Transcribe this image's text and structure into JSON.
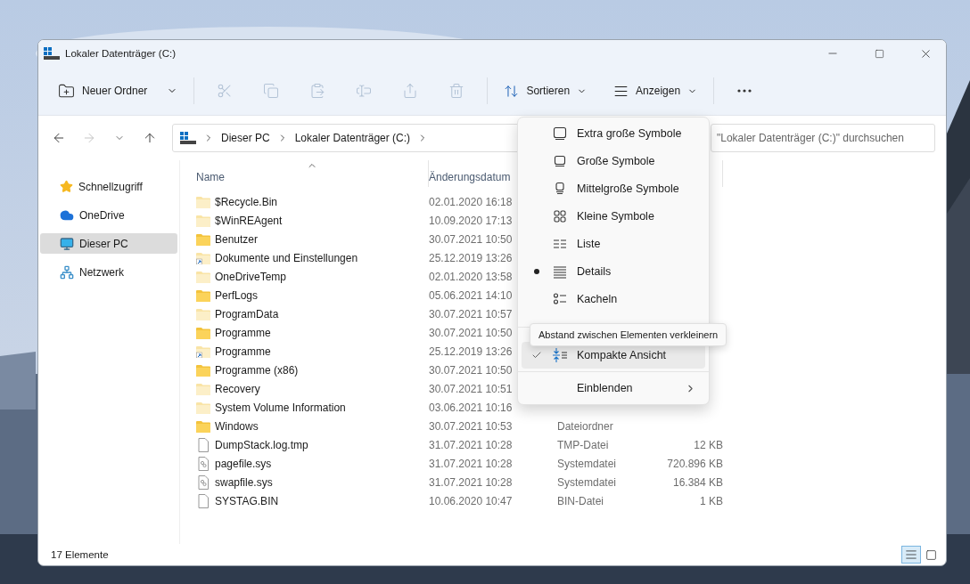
{
  "window": {
    "title": "Lokaler Datenträger (C:)"
  },
  "toolbar": {
    "new_button": {
      "label": "Neuer Ordner"
    },
    "actions": [
      {
        "kind": "cut",
        "disabled": true
      },
      {
        "kind": "copy",
        "disabled": true
      },
      {
        "kind": "paste",
        "disabled": true
      },
      {
        "kind": "rename",
        "disabled": true
      },
      {
        "kind": "share",
        "disabled": true
      },
      {
        "kind": "delete",
        "disabled": true
      }
    ],
    "sort_button": {
      "label": "Sortieren"
    },
    "view_button": {
      "label": "Anzeigen"
    }
  },
  "navigation": [
    {
      "kind": "back",
      "disabled": false
    },
    {
      "kind": "forward",
      "disabled": true
    },
    {
      "kind": "recent",
      "disabled": false
    },
    {
      "kind": "up",
      "disabled": false
    }
  ],
  "breadcrumb": [
    "Dieser PC",
    "Lokaler Datenträger (C:)"
  ],
  "search": {
    "placeholder": "\"Lokaler Datenträger (C:)\" durchsuchen"
  },
  "sidebar": {
    "items": [
      {
        "label": "Schnellzugriff",
        "kind": "star",
        "selected": false
      },
      {
        "label": "OneDrive",
        "kind": "cloud",
        "selected": false
      },
      {
        "label": "Dieser PC",
        "kind": "pc",
        "selected": true
      },
      {
        "label": "Netzwerk",
        "kind": "network",
        "selected": false
      }
    ]
  },
  "table": {
    "columns": [
      {
        "label": "Name",
        "sorted": true
      },
      {
        "label": "Änderungsdatum",
        "sorted": false
      }
    ],
    "rows": [
      {
        "name": "$Recycle.Bin",
        "date": "02.01.2020 16:18",
        "kind": "hidden-folder"
      },
      {
        "name": "$WinREAgent",
        "date": "10.09.2020 17:13",
        "kind": "hidden-folder"
      },
      {
        "name": "Benutzer",
        "date": "30.07.2021 10:50",
        "kind": "folder"
      },
      {
        "name": "Dokumente und Einstellungen",
        "date": "25.12.2019 13:26",
        "kind": "link"
      },
      {
        "name": "OneDriveTemp",
        "date": "02.01.2020 13:58",
        "kind": "hidden-folder"
      },
      {
        "name": "PerfLogs",
        "date": "05.06.2021 14:10",
        "kind": "folder"
      },
      {
        "name": "ProgramData",
        "date": "30.07.2021 10:57",
        "kind": "hidden-folder"
      },
      {
        "name": "Programme",
        "date": "30.07.2021 10:50",
        "kind": "folder"
      },
      {
        "name": "Programme",
        "date": "25.12.2019 13:26",
        "kind": "link"
      },
      {
        "name": "Programme (x86)",
        "date": "30.07.2021 10:50",
        "kind": "folder"
      },
      {
        "name": "Recovery",
        "date": "30.07.2021 10:51",
        "kind": "hidden-folder"
      },
      {
        "name": "System Volume Information",
        "date": "03.06.2021 10:16",
        "kind": "hidden-folder"
      },
      {
        "name": "Windows",
        "date": "30.07.2021 10:53",
        "type": "Dateiordner",
        "kind": "folder"
      },
      {
        "name": "DumpStack.log.tmp",
        "date": "31.07.2021 10:28",
        "type": "TMP-Datei",
        "size": "12 KB",
        "kind": "file"
      },
      {
        "name": "pagefile.sys",
        "date": "31.07.2021 10:28",
        "type": "Systemdatei",
        "size": "720.896 KB",
        "kind": "system-file"
      },
      {
        "name": "swapfile.sys",
        "date": "31.07.2021 10:28",
        "type": "Systemdatei",
        "size": "16.384 KB",
        "kind": "system-file"
      },
      {
        "name": "SYSTAG.BIN",
        "date": "10.06.2020 10:47",
        "type": "BIN-Datei",
        "size": "1 KB",
        "kind": "file"
      }
    ]
  },
  "view_menu": {
    "items": [
      {
        "kind": "radio",
        "label": "Extra große Symbole",
        "selected": false,
        "hovered": false
      },
      {
        "kind": "radio",
        "label": "Große Symbole",
        "selected": false,
        "hovered": false
      },
      {
        "kind": "radio",
        "label": "Mittelgroße Symbole",
        "selected": false,
        "hovered": false
      },
      {
        "kind": "radio",
        "label": "Kleine Symbole",
        "selected": false,
        "hovered": false
      },
      {
        "kind": "radio",
        "label": "Liste",
        "selected": false,
        "hovered": false
      },
      {
        "kind": "radio",
        "label": "Details",
        "selected": true,
        "hovered": false
      },
      {
        "kind": "radio",
        "label": "Kacheln",
        "selected": false,
        "hovered": false
      },
      {
        "kind": "toggle",
        "label": "Kompakte Ansicht",
        "checked": true,
        "hovered": true
      },
      {
        "kind": "submenu",
        "label": "Einblenden",
        "hovered": false
      }
    ],
    "tooltip": "Abstand zwischen Elementen verkleinern"
  },
  "status_bar": {
    "count": "17 Elemente",
    "view_toggles": [
      {
        "kind": "details",
        "selected": true
      },
      {
        "kind": "large-icons",
        "selected": false
      }
    ]
  }
}
